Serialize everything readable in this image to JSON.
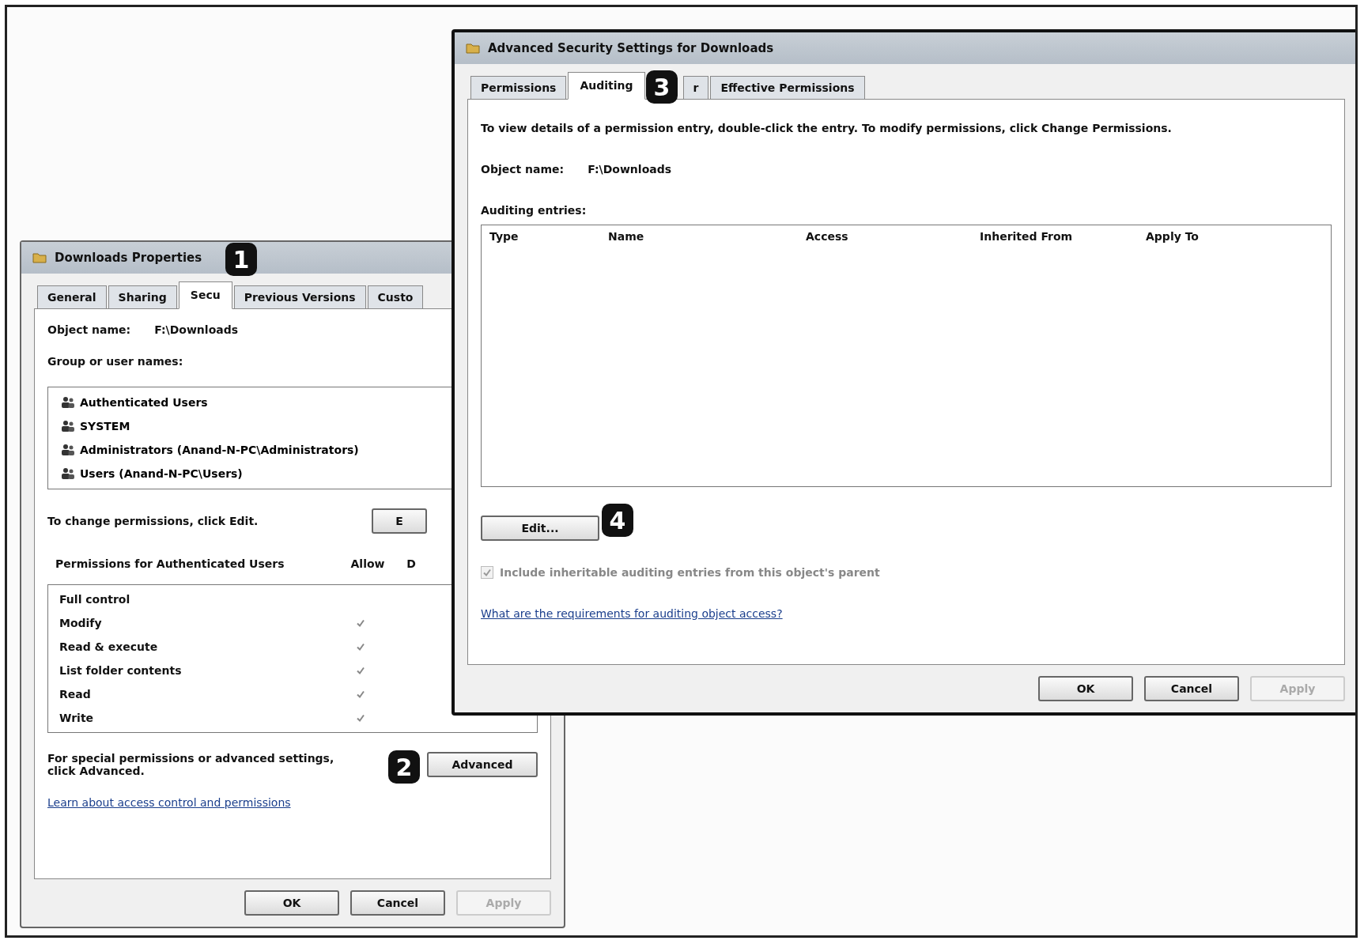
{
  "properties_window": {
    "title": "Downloads Properties",
    "tabs": [
      {
        "label": "General",
        "selected": false
      },
      {
        "label": "Sharing",
        "selected": false
      },
      {
        "label": "Secu",
        "selected": true
      },
      {
        "label": "Previous Versions",
        "selected": false
      },
      {
        "label": "Custo",
        "selected": false
      }
    ],
    "object_label": "Object name:",
    "object_value": "F:\\Downloads",
    "group_label": "Group or user names:",
    "groups": [
      {
        "name": "Authenticated Users",
        "selected": false
      },
      {
        "name": "SYSTEM",
        "selected": false
      },
      {
        "name": "Administrators (Anand-N-PC\\Administrators)",
        "selected": false
      },
      {
        "name": "Users (Anand-N-PC\\Users)",
        "selected": false
      }
    ],
    "change_text": "To change permissions, click Edit.",
    "edit_button": "E",
    "permissions_label": "Permissions for Authenticated Users",
    "columns": [
      "Allow",
      "D"
    ],
    "permissions": [
      {
        "name": "Full control",
        "allow": false
      },
      {
        "name": "Modify",
        "allow": true
      },
      {
        "name": "Read & execute",
        "allow": true
      },
      {
        "name": "List folder contents",
        "allow": true
      },
      {
        "name": "Read",
        "allow": true
      },
      {
        "name": "Write",
        "allow": true
      }
    ],
    "advanced_text": "For special permissions or advanced settings, click Advanced.",
    "advanced_button": "Advanced",
    "link": "Learn about access control and permissions",
    "buttons": [
      {
        "label": "OK",
        "disabled": false
      },
      {
        "label": "Cancel",
        "disabled": false
      },
      {
        "label": "Apply",
        "disabled": true
      }
    ]
  },
  "advanced_window": {
    "title": "Advanced Security Settings for Downloads",
    "tabs": [
      {
        "label": "Permissions",
        "selected": false
      },
      {
        "label": "Auditing",
        "selected": true
      },
      {
        "label": "r",
        "selected": false
      },
      {
        "label": "Effective Permissions",
        "selected": false
      }
    ],
    "info": "To view details of a permission entry, double-click the entry. To modify permissions, click Change Permissions.",
    "object_label": "Object name:",
    "object_value": "F:\\Downloads",
    "entries_label": "Auditing entries:",
    "columns": [
      "Type",
      "Name",
      "Access",
      "Inherited From",
      "Apply To"
    ],
    "edit_button": "Edit...",
    "include": {
      "label": "Include inheritable auditing entries from this object's parent",
      "checked": true,
      "disabled": true
    },
    "link": "What are the requirements for auditing object access?",
    "buttons": [
      {
        "label": "OK",
        "disabled": false
      },
      {
        "label": "Cancel",
        "disabled": false
      },
      {
        "label": "Apply",
        "disabled": true
      }
    ]
  },
  "step_badges": [
    "1",
    "2",
    "3",
    "4"
  ]
}
